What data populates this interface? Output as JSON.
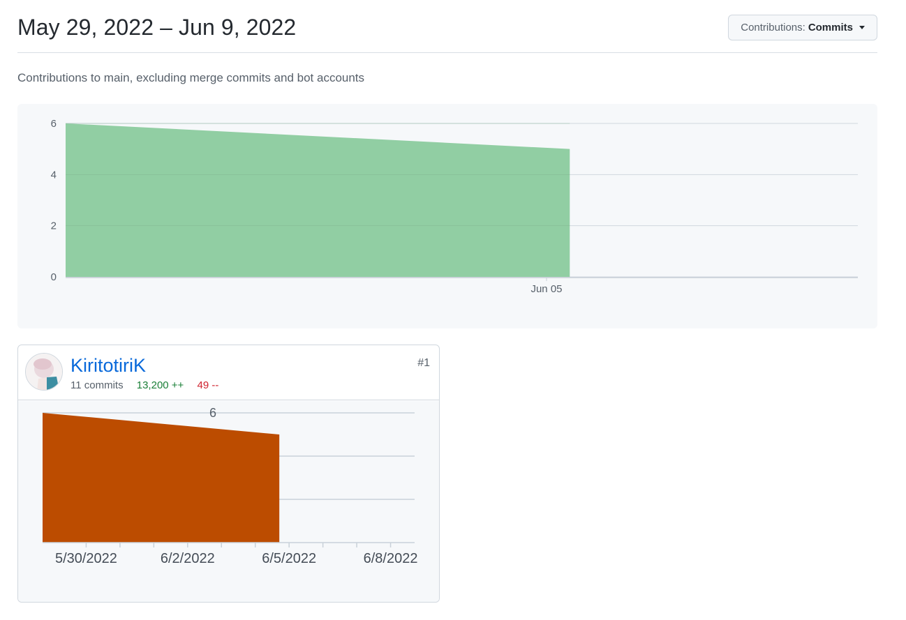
{
  "header": {
    "date_range": "May 29, 2022 – Jun 9, 2022",
    "contributions_label": "Contributions:",
    "contributions_value": "Commits"
  },
  "subtitle": "Contributions to main, excluding merge commits and bot accounts",
  "colors": {
    "main_fill": "#91cea3",
    "user_fill": "#bc4c00",
    "grid": "#d0d7de",
    "axis_text": "#57606a"
  },
  "contributor": {
    "name": "KiritotiriK",
    "rank": "#1",
    "commits": "11 commits",
    "additions": "13,200 ++",
    "deletions": "49 --"
  },
  "chart_data": [
    {
      "type": "area",
      "x": [
        "2022-05-29",
        "2022-06-05"
      ],
      "y": [
        6,
        5
      ],
      "x_tick_labels": [
        "Jun 05"
      ],
      "y_ticks": [
        0,
        2,
        4,
        6
      ],
      "ylim": [
        0,
        6
      ],
      "xlim": [
        "2022-05-29",
        "2022-06-09"
      ],
      "grid": true,
      "title": "",
      "xlabel": "",
      "ylabel": ""
    },
    {
      "type": "area",
      "x": [
        "2022-05-29",
        "2022-06-05"
      ],
      "y": [
        6,
        5
      ],
      "x_tick_labels": [
        "5/30/2022",
        "6/2/2022",
        "6/5/2022",
        "6/8/2022"
      ],
      "y_tick_labels": [
        "6"
      ],
      "ylim": [
        0,
        6
      ],
      "xlim": [
        "2022-05-29",
        "2022-06-09"
      ],
      "grid": true,
      "title": "",
      "xlabel": "",
      "ylabel": ""
    }
  ]
}
